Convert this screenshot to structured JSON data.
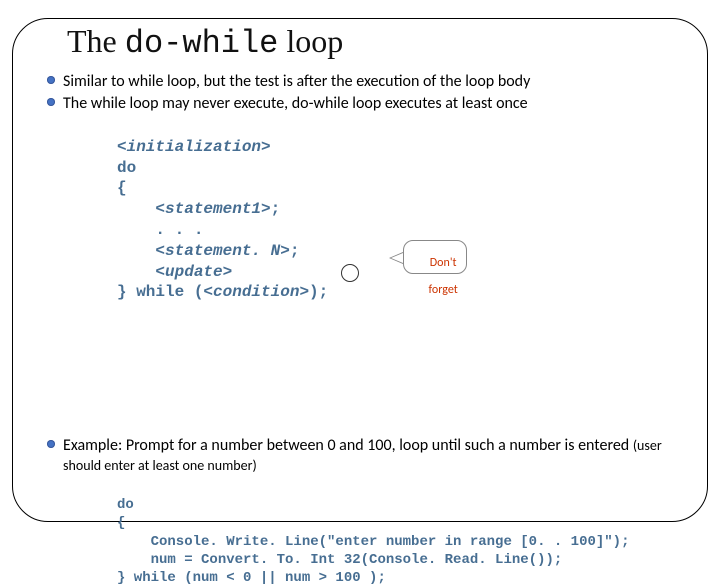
{
  "title_prefix": "The ",
  "title_code": "do-while",
  "title_suffix": " loop",
  "bullets": [
    "Similar to while loop, but the test is after the execution of the loop body",
    "The while loop may never execute, do-while loop executes at least once"
  ],
  "code": {
    "l1": "<initialization>",
    "l2": "do",
    "l3": "{",
    "l4": "<statement1>",
    "l5": ". . .",
    "l6": "<statement. N>",
    "l7": "<update>",
    "l8a": "} while (",
    "l8b": "<condition>",
    "l8c": ");",
    "semi_mark_char": ";"
  },
  "callout": {
    "line1": "Don't",
    "line2": "forget"
  },
  "example": {
    "intro_a": "Example: Prompt for a number between 0 and 100, loop until such a number is entered ",
    "intro_b": "(user should enter at least one number)",
    "c1": "do",
    "c2": "{",
    "c3": "    Console. Write. Line(\"enter number in range [0. . 100]\");",
    "c4": "    num = Convert. To. Int 32(Console. Read. Line());",
    "c5": "} while (num < 0 || num > 100 );"
  }
}
